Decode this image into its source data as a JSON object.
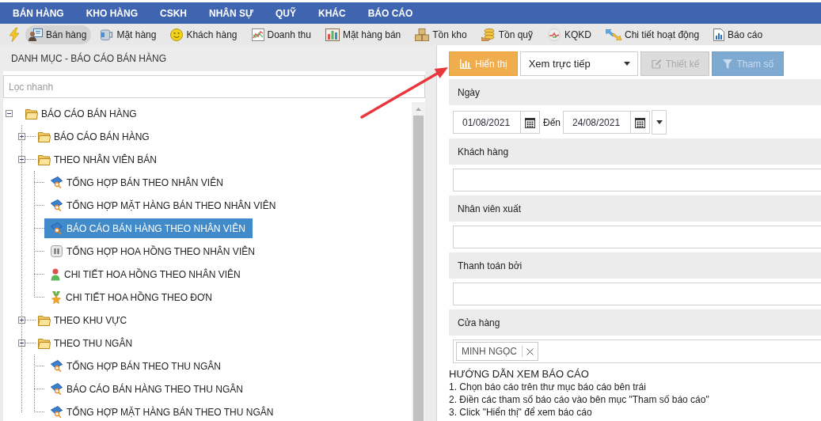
{
  "top_menu": [
    "BÁN HÀNG",
    "KHO HÀNG",
    "CSKH",
    "NHÂN SỰ",
    "QUỸ",
    "KHÁC",
    "BÁO CÁO"
  ],
  "toolbar": [
    {
      "label": "Bán hàng",
      "selected": true
    },
    {
      "label": "Mặt hàng",
      "selected": false
    },
    {
      "label": "Khách hàng",
      "selected": false
    },
    {
      "label": "Doanh thu",
      "selected": false
    },
    {
      "label": "Mặt hàng bán",
      "selected": false
    },
    {
      "label": "Tồn kho",
      "selected": false
    },
    {
      "label": "Tồn quỹ",
      "selected": false
    },
    {
      "label": "KQKD",
      "selected": false
    },
    {
      "label": "Chi tiết hoạt động",
      "selected": false
    },
    {
      "label": "Báo cáo",
      "selected": false
    }
  ],
  "sidebar": {
    "title": "DANH MỤC - BÁO CÁO BÁN HÀNG",
    "filter": {
      "placeholder": "Lọc nhanh"
    },
    "tree": [
      {
        "kind": "folder",
        "label": "BÁO CÁO BÁN HÀNG",
        "expanded": true,
        "selected": false,
        "children": [
          {
            "kind": "folder",
            "label": "BÁO CÁO BÁN HÀNG",
            "expanded": false,
            "selected": false
          },
          {
            "kind": "folder",
            "label": "THEO NHÂN VIÊN BÁN",
            "expanded": true,
            "selected": false,
            "children": [
              {
                "kind": "report",
                "label": "TỔNG HỢP BÁN THEO NHÂN VIÊN",
                "selected": false
              },
              {
                "kind": "report",
                "label": "TỔNG HỢP MẶT HÀNG BÁN THEO NHÂN VIÊN",
                "selected": false
              },
              {
                "kind": "report",
                "label": "BÁO CÁO BÁN HÀNG THEO NHÂN VIÊN",
                "selected": true
              },
              {
                "kind": "commission",
                "label": "TỔNG HỢP HOA HỒNG THEO NHÂN VIÊN",
                "selected": false
              },
              {
                "kind": "person",
                "label": "CHI TIẾT HOA HỒNG THEO NHÂN VIÊN",
                "selected": false
              },
              {
                "kind": "medal",
                "label": "CHI TIẾT HOA HỒNG THEO ĐƠN",
                "selected": false
              }
            ]
          },
          {
            "kind": "folder",
            "label": "THEO KHU VỰC",
            "expanded": false,
            "selected": false
          },
          {
            "kind": "folder",
            "label": "THEO THU NGÂN",
            "expanded": true,
            "selected": false,
            "children": [
              {
                "kind": "report",
                "label": "TỔNG HỢP BÁN THEO THU NGÂN",
                "selected": false
              },
              {
                "kind": "report",
                "label": "BÁO CÁO BÁN HÀNG THEO THU NGÂN",
                "selected": false
              },
              {
                "kind": "report",
                "label": "TỔNG HỢP MẶT HÀNG BÁN THEO THU NGÂN",
                "selected": false
              }
            ]
          }
        ]
      }
    ]
  },
  "report_panel": {
    "actions": [
      {
        "kind": "button",
        "label": "Hiển thị",
        "disabled": false
      },
      {
        "kind": "select",
        "value": "Xem trực tiếp"
      },
      {
        "kind": "button",
        "label": "Thiết kế",
        "disabled": true
      },
      {
        "kind": "button",
        "label": "Tham số",
        "disabled": true
      }
    ],
    "filters": [
      {
        "kind": "date_range",
        "label": "Ngày",
        "from": "01/08/2021",
        "separator": "Đến",
        "to": "24/08/2021"
      },
      {
        "kind": "text",
        "label": "Khách hàng"
      },
      {
        "kind": "text",
        "label": "Nhân viên xuất"
      },
      {
        "kind": "text",
        "label": "Thanh toán bởi"
      },
      {
        "kind": "tags",
        "label": "Cửa hàng",
        "tags": [
          "MINH NGỌC"
        ]
      }
    ],
    "guide": {
      "title": "HƯỚNG DẪN XEM BÁO CÁO",
      "steps": [
        "1. Chọn báo cáo trên thư mục báo cáo bên trái",
        "2. Điền các tham số báo cáo vào bên mục \"Tham số báo cáo\"",
        "3. Click \"Hiển thị\" để xem báo cáo"
      ]
    }
  }
}
